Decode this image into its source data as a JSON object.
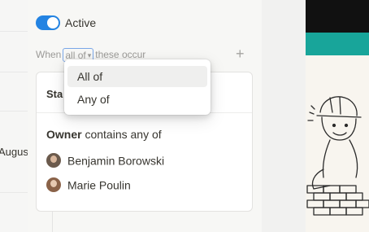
{
  "background": {
    "month_label": "Augus"
  },
  "automation": {
    "toggle_on": true,
    "active_label": "Active",
    "when_prefix": "When",
    "condition_mode": "all of",
    "when_suffix": "these occur"
  },
  "card": {
    "header_fragment": "Sta",
    "owner_label": "Owner",
    "owner_operator": "contains any of",
    "people": [
      {
        "name": "Benjamin Borowski"
      },
      {
        "name": "Marie Poulin"
      }
    ]
  },
  "dropdown": {
    "options": [
      "All of",
      "Any of"
    ],
    "highlighted": "All of"
  },
  "colors": {
    "accent": "#2383e2",
    "teal_banner": "#18a59a"
  }
}
